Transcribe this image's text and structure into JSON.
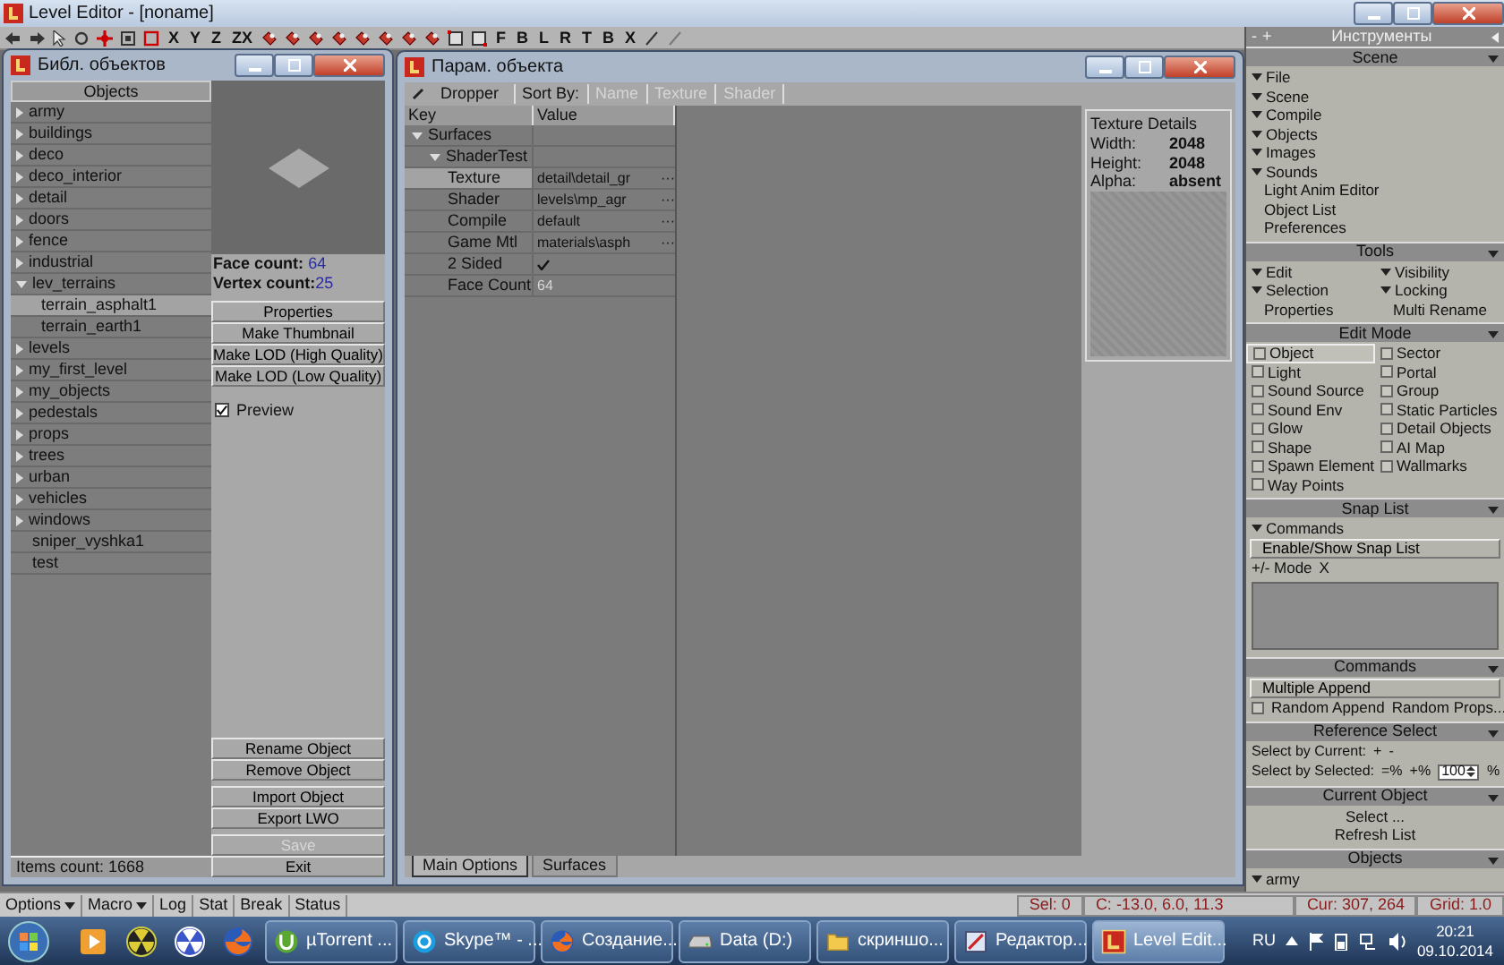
{
  "window": {
    "title": "Level Editor - [noname]"
  },
  "toolbar": {
    "axis_buttons": [
      "X",
      "Y",
      "Z",
      "ZX"
    ],
    "view_buttons": [
      "F",
      "B",
      "L",
      "R",
      "T",
      "B",
      "X"
    ]
  },
  "library": {
    "title": "Библ. объектов",
    "header": "Objects",
    "items": [
      {
        "label": "army",
        "expanded": false,
        "selected": false
      },
      {
        "label": "buildings",
        "expanded": false,
        "selected": false
      },
      {
        "label": "deco",
        "expanded": false,
        "selected": false
      },
      {
        "label": "deco_interior",
        "expanded": false,
        "selected": false
      },
      {
        "label": "detail",
        "expanded": false,
        "selected": false
      },
      {
        "label": "doors",
        "expanded": false,
        "selected": false
      },
      {
        "label": "fence",
        "expanded": false,
        "selected": false
      },
      {
        "label": "industrial",
        "expanded": false,
        "selected": false
      },
      {
        "label": "lev_terrains",
        "expanded": true,
        "selected": false,
        "children": [
          {
            "label": "terrain_asphalt1",
            "selected": true
          },
          {
            "label": "terrain_earth1",
            "selected": false
          }
        ]
      },
      {
        "label": "levels",
        "expanded": false,
        "selected": false
      },
      {
        "label": "my_first_level",
        "expanded": false,
        "selected": false
      },
      {
        "label": "my_objects",
        "expanded": false,
        "selected": false
      },
      {
        "label": "pedestals",
        "expanded": false,
        "selected": false
      },
      {
        "label": "props",
        "expanded": false,
        "selected": false
      },
      {
        "label": "trees",
        "expanded": false,
        "selected": false
      },
      {
        "label": "urban",
        "expanded": false,
        "selected": false
      },
      {
        "label": "vehicles",
        "expanded": false,
        "selected": false
      },
      {
        "label": "windows",
        "expanded": false,
        "selected": false
      },
      {
        "label": "sniper_vyshka1",
        "selected": false
      },
      {
        "label": "test",
        "selected": false
      }
    ],
    "face_count_label": "Face count:",
    "face_count": "64",
    "vertex_count_label": "Vertex count:",
    "vertex_count": "25",
    "top_buttons": [
      {
        "label": "Properties",
        "disabled": false
      },
      {
        "label": "Make Thumbnail",
        "disabled": false
      },
      {
        "label": "Make LOD (High Quality)",
        "disabled": false
      },
      {
        "label": "Make LOD (Low Quality)",
        "disabled": false
      }
    ],
    "preview": {
      "label": "Preview",
      "checked": true
    },
    "bottom_buttons": [
      {
        "label": "Rename Object",
        "disabled": false
      },
      {
        "label": "Remove Object",
        "disabled": false
      },
      {
        "label": "Import Object",
        "disabled": false
      },
      {
        "label": "Export LWO",
        "disabled": false
      },
      {
        "label": "Save",
        "disabled": true
      },
      {
        "label": "Exit",
        "disabled": false
      }
    ],
    "items_count": "Items count: 1668"
  },
  "dialog": {
    "title": "Парам. объекта",
    "dropper": "Dropper",
    "sort_label": "Sort By:",
    "sort_tabs": [
      {
        "label": "Name",
        "disabled": true
      },
      {
        "label": "Texture",
        "disabled": true
      },
      {
        "label": "Shader",
        "disabled": true
      }
    ],
    "columns": [
      "Key",
      "Value"
    ],
    "rows": [
      {
        "key": "Surfaces",
        "expanded": true,
        "children": [
          {
            "key": "ShaderTest",
            "expanded": true,
            "children": [
              {
                "key": "Texture",
                "value": "detail\\detail_gr",
                "kind": "choice",
                "button": "···",
                "selected": true
              },
              {
                "key": "Shader",
                "value": "levels\\mp_agr",
                "kind": "choice",
                "button": "···",
                "selected": false
              },
              {
                "key": "Compile",
                "value": "default",
                "kind": "choice",
                "button": "···",
                "selected": false
              },
              {
                "key": "Game Mtl",
                "value": "materials\\asph",
                "kind": "choice",
                "button": "···",
                "selected": false
              },
              {
                "key": "2 Sided",
                "kind": "check",
                "checked": true,
                "selected": false
              },
              {
                "key": "Face Count",
                "value": "64",
                "kind": "readonly",
                "selected": false
              }
            ]
          }
        ]
      }
    ],
    "texture_details": {
      "title": "Texture Details",
      "fields": [
        {
          "label": "Width:",
          "value": "2048"
        },
        {
          "label": "Height:",
          "value": "2048"
        },
        {
          "label": "Alpha:",
          "value": "absent"
        }
      ]
    },
    "bottom_tabs": [
      {
        "label": "Main Options",
        "selected": true
      },
      {
        "label": "Surfaces",
        "selected": false
      }
    ]
  },
  "tools": {
    "title": "Инструменты",
    "header_buttons": [
      "-",
      "+"
    ],
    "sections": [
      {
        "title": "Scene",
        "kind": "list",
        "items": [
          {
            "kind": "submenu",
            "label": "File"
          },
          {
            "kind": "submenu",
            "label": "Scene"
          },
          {
            "kind": "submenu",
            "label": "Compile"
          },
          {
            "kind": "submenu",
            "label": "Objects"
          },
          {
            "kind": "submenu",
            "label": "Images"
          },
          {
            "kind": "submenu",
            "label": "Sounds"
          },
          {
            "kind": "action",
            "label": "Light Anim Editor"
          },
          {
            "kind": "action",
            "label": "Object List"
          },
          {
            "kind": "action",
            "label": "Preferences"
          }
        ]
      },
      {
        "title": "Tools",
        "kind": "grid",
        "items": [
          {
            "kind": "submenu",
            "label": "Edit"
          },
          {
            "kind": "submenu",
            "label": "Visibility"
          },
          {
            "kind": "submenu",
            "label": "Selection"
          },
          {
            "kind": "submenu",
            "label": "Locking"
          },
          {
            "kind": "action",
            "label": "Properties"
          },
          {
            "kind": "action",
            "label": "Multi Rename"
          }
        ]
      },
      {
        "title": "Edit Mode",
        "kind": "grid",
        "items": [
          {
            "kind": "mode",
            "label": "Object",
            "selected": true
          },
          {
            "kind": "mode",
            "label": "Sector",
            "selected": false
          },
          {
            "kind": "mode",
            "label": "Light",
            "selected": false
          },
          {
            "kind": "mode",
            "label": "Portal",
            "selected": false
          },
          {
            "kind": "mode",
            "label": "Sound Source",
            "selected": false
          },
          {
            "kind": "mode",
            "label": "Group",
            "selected": false
          },
          {
            "kind": "mode",
            "label": "Sound Env",
            "selected": false
          },
          {
            "kind": "mode",
            "label": "Static Particles",
            "selected": false
          },
          {
            "kind": "mode",
            "label": "Glow",
            "selected": false
          },
          {
            "kind": "mode",
            "label": "Detail Objects",
            "selected": false
          },
          {
            "kind": "mode",
            "label": "Shape",
            "selected": false
          },
          {
            "kind": "mode",
            "label": "AI Map",
            "selected": false
          },
          {
            "kind": "mode",
            "label": "Spawn Element",
            "selected": false
          },
          {
            "kind": "mode",
            "label": "Wallmarks",
            "selected": false
          },
          {
            "kind": "mode",
            "label": "Way Points",
            "selected": false
          }
        ]
      },
      {
        "title": "Snap List",
        "kind": "list",
        "items": [
          {
            "kind": "submenu",
            "label": "Commands"
          },
          {
            "kind": "button",
            "label": "Enable/Show Snap List"
          },
          {
            "kind": "row",
            "controls": [
              {
                "kind": "text",
                "label": "+/- Mode"
              },
              {
                "kind": "text",
                "label": "X"
              }
            ]
          },
          {
            "kind": "box"
          }
        ]
      },
      {
        "title": "Commands",
        "kind": "list",
        "items": [
          {
            "kind": "button",
            "label": "Multiple Append"
          },
          {
            "kind": "row",
            "controls": [
              {
                "kind": "check",
                "label": "Random Append",
                "checked": false
              },
              {
                "kind": "action",
                "label": "Random Props..."
              }
            ]
          }
        ]
      },
      {
        "title": "Reference Select",
        "kind": "list",
        "items": [
          {
            "kind": "row",
            "label": "Select by Current:",
            "controls": [
              {
                "kind": "action",
                "label": "+"
              },
              {
                "kind": "action",
                "label": "-"
              }
            ]
          },
          {
            "kind": "row",
            "label": "Select by Selected:",
            "controls": [
              {
                "kind": "action",
                "label": "=%"
              },
              {
                "kind": "action",
                "label": "+%"
              },
              {
                "kind": "spin",
                "value": "100"
              },
              {
                "kind": "text",
                "label": "%"
              }
            ]
          }
        ]
      },
      {
        "title": "Current Object",
        "kind": "list",
        "items": [
          {
            "kind": "center",
            "label": "Select ..."
          },
          {
            "kind": "center",
            "label": "Refresh List"
          }
        ]
      },
      {
        "title": "Objects",
        "kind": "list",
        "items": [
          {
            "kind": "submenu",
            "label": "army"
          }
        ]
      }
    ]
  },
  "status_bar": {
    "buttons": [
      {
        "label": "Options",
        "dropdown": true
      },
      {
        "label": "Macro",
        "dropdown": true
      },
      {
        "label": "Log",
        "dropdown": false
      },
      {
        "label": "Stat",
        "dropdown": false
      },
      {
        "label": "Break",
        "dropdown": false
      },
      {
        "label": "Status",
        "dropdown": false
      }
    ],
    "fields": [
      "Sel: 0",
      "C: -13.0, 6.0, 11.3",
      "Cur: 307, 264",
      "Grid: 1.0"
    ]
  },
  "taskbar": {
    "pinned": [
      {
        "kind": "player"
      },
      {
        "kind": "radiation"
      },
      {
        "kind": "radiation2"
      },
      {
        "kind": "browser"
      }
    ],
    "buttons": [
      {
        "kind": "torrent",
        "label": "µTorrent ...",
        "selected": false
      },
      {
        "kind": "chat",
        "label": "Skype™ - ...",
        "selected": false
      },
      {
        "kind": "browser",
        "label": "Создание...",
        "selected": false
      },
      {
        "kind": "drive",
        "label": "Data (D:)",
        "selected": false
      },
      {
        "kind": "folder",
        "label": "скриншо...",
        "selected": false
      },
      {
        "kind": "editor",
        "label": "Редактор...",
        "selected": false
      },
      {
        "kind": "level",
        "label": "Level Edit...",
        "selected": true
      }
    ],
    "language": "RU",
    "time": "20:21",
    "date": "09.10.2014"
  }
}
